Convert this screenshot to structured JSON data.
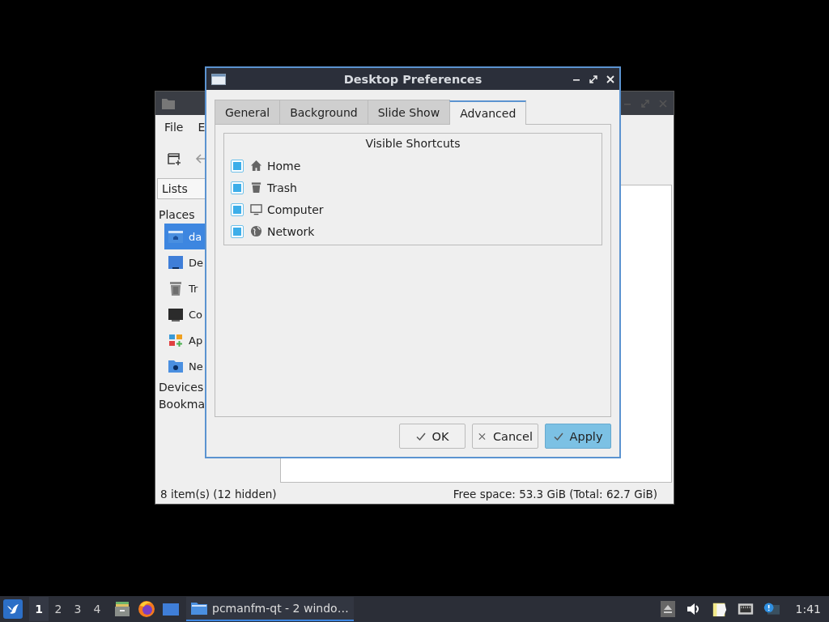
{
  "file_manager": {
    "menu": [
      "File",
      "E"
    ],
    "side_pane_mode": "Lists",
    "places_heading": "Places",
    "places": [
      {
        "label": "da",
        "kind": "home",
        "selected": true
      },
      {
        "label": "De",
        "kind": "desktop",
        "selected": false
      },
      {
        "label": "Tr",
        "kind": "trash",
        "selected": false
      },
      {
        "label": "Co",
        "kind": "computer",
        "selected": false
      },
      {
        "label": "Ap",
        "kind": "apps",
        "selected": false
      },
      {
        "label": "Ne",
        "kind": "network",
        "selected": false
      }
    ],
    "sections": [
      "Devices",
      "Bookma"
    ],
    "status_left": "8 item(s) (12 hidden)",
    "status_right": "Free space: 53.3 GiB (Total: 62.7 GiB)"
  },
  "dialog": {
    "title": "Desktop Preferences",
    "tabs": [
      {
        "label": "General",
        "selected": false
      },
      {
        "label": "Background",
        "selected": false
      },
      {
        "label": "Slide Show",
        "selected": false
      },
      {
        "label": "Advanced",
        "selected": true
      }
    ],
    "group_title": "Visible Shortcuts",
    "shortcuts": [
      {
        "label": "Home",
        "kind": "home",
        "checked": true
      },
      {
        "label": "Trash",
        "kind": "trash",
        "checked": true
      },
      {
        "label": "Computer",
        "kind": "computer",
        "checked": true
      },
      {
        "label": "Network",
        "kind": "network",
        "checked": true
      }
    ],
    "buttons": [
      {
        "label": "OK",
        "kind": "ok",
        "default": false
      },
      {
        "label": "Cancel",
        "kind": "cancel",
        "default": false
      },
      {
        "label": "Apply",
        "kind": "apply",
        "default": true
      }
    ]
  },
  "taskbar": {
    "workspaces": [
      {
        "label": "1",
        "selected": true
      },
      {
        "label": "2",
        "selected": false
      },
      {
        "label": "3",
        "selected": false
      },
      {
        "label": "4",
        "selected": false
      }
    ],
    "task": "pcmanfm-qt - 2 windo…",
    "clock": "1:41"
  }
}
